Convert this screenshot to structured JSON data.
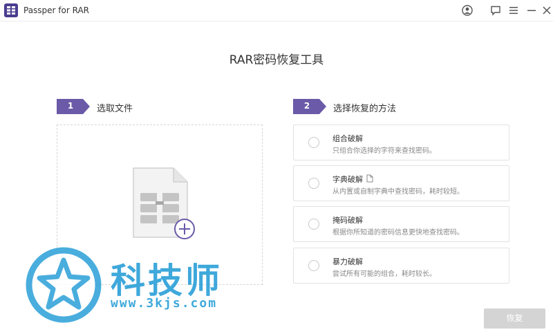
{
  "window": {
    "title": "Passper for RAR",
    "icons": [
      "app-logo",
      "account-icon",
      "feedback-icon",
      "menu-icon",
      "minimize-icon",
      "close-icon"
    ]
  },
  "main": {
    "headline": "RAR密码恢复工具"
  },
  "step1": {
    "number": "1",
    "label": "选取文件",
    "dropzone_icon": "add-rar-file-icon"
  },
  "step2": {
    "number": "2",
    "label": "选择恢复的方法",
    "methods": [
      {
        "title": "组合破解",
        "desc": "只组合你选择的字符来查找密码。"
      },
      {
        "title": "字典破解",
        "desc": "从内置或自制字典中查找密码，耗时较短。"
      },
      {
        "title": "掩码破解",
        "desc": "根据你所知道的密码信息更快地查找密码。"
      },
      {
        "title": "暴力破解",
        "desc": "尝试所有可能的组合，耗时较长。"
      }
    ]
  },
  "actions": {
    "recover_label": "恢复"
  },
  "watermark": {
    "text": "科技师",
    "url": "www.3kjs.com"
  },
  "colors": {
    "accent": "#6a5aa8",
    "button_disabled": "#d4d4d4",
    "watermark": "#2a9fd8"
  }
}
